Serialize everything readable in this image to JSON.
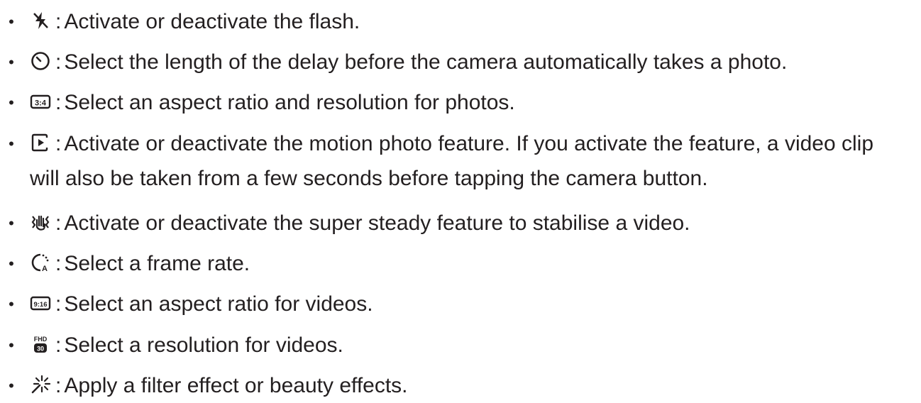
{
  "bullet": "•",
  "separator": ":",
  "items": [
    {
      "icon": "flash-off-icon",
      "text": "Activate or deactivate the flash."
    },
    {
      "icon": "timer-icon",
      "text": "Select the length of the delay before the camera automatically takes a photo."
    },
    {
      "icon": "aspect-ratio-3-4-icon",
      "icon_label": "3:4",
      "text": "Select an aspect ratio and resolution for photos."
    },
    {
      "icon": "motion-photo-icon",
      "text": "Activate or deactivate the motion photo feature. If you activate the feature, a video clip will also be taken from a few seconds before tapping the camera button."
    },
    {
      "icon": "super-steady-icon",
      "text": "Activate or deactivate the super steady feature to stabilise a video."
    },
    {
      "icon": "frame-rate-auto-icon",
      "icon_label": "A",
      "text": "Select a frame rate."
    },
    {
      "icon": "aspect-ratio-9-16-icon",
      "icon_label": "9:16",
      "text": "Select an aspect ratio for videos."
    },
    {
      "icon": "video-resolution-icon",
      "icon_label_top": "FHD",
      "icon_label_bottom": "30",
      "text": "Select a resolution for videos."
    },
    {
      "icon": "filter-effects-icon",
      "text": "Apply a filter effect or beauty effects."
    }
  ]
}
